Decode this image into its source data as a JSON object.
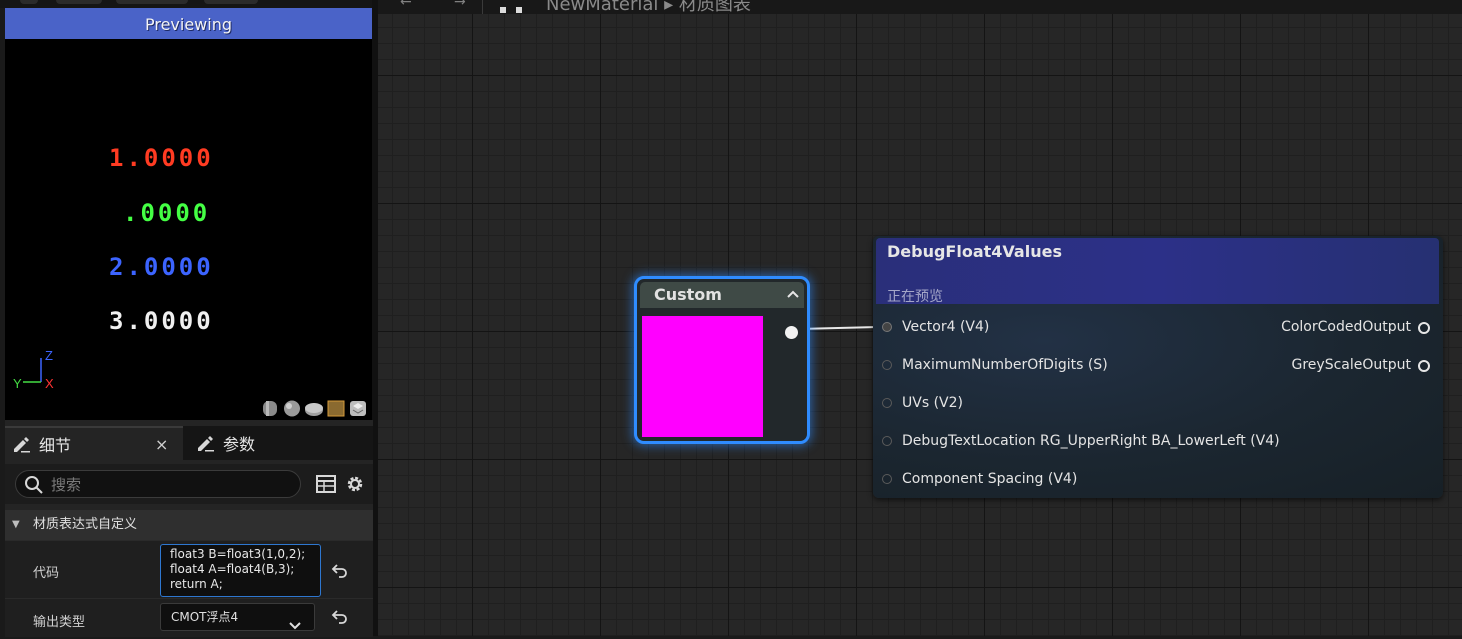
{
  "preview": {
    "banner": "Previewing",
    "debug_lines": [
      {
        "text": "1.0000",
        "color": "#ff3b22"
      },
      {
        "text": ".0000",
        "color": "#44ff44"
      },
      {
        "text": "2.0000",
        "color": "#3c64ff"
      },
      {
        "text": "3.0000",
        "color": "#f0f0f0"
      }
    ],
    "axis": {
      "z": "Z",
      "y": "Y",
      "x": "X",
      "z_color": "#3c64ff",
      "y_color": "#44dd44",
      "x_color": "#ff3333"
    }
  },
  "details": {
    "tabs": [
      {
        "label": "细节",
        "icon": "edit-icon",
        "active": true
      },
      {
        "label": "参数",
        "icon": "edit-icon",
        "active": false
      }
    ],
    "close_label": "×",
    "search_placeholder": "搜索",
    "section_title": "材质表达式自定义",
    "properties": {
      "code_label": "代码",
      "code_value": "float3 B=float3(1,0,2);\nfloat4 A=float4(B,3);\nreturn A;",
      "output_type_label": "输出类型",
      "output_type_value": "CMOT浮点4"
    }
  },
  "graph": {
    "breadcrumb": "NewMaterial ▸ 材质图表",
    "custom_node": {
      "title": "Custom",
      "preview_color": "#ff00ff",
      "border_color": "#2f8cff"
    },
    "debug_node": {
      "title": "DebugFloat4Values",
      "status": "正在预览",
      "inputs": [
        "Vector4 (V4)",
        "MaximumNumberOfDigits (S)",
        "UVs (V2)",
        "DebugTextLocation RG_UpperRight BA_LowerLeft (V4)",
        "Component Spacing (V4)"
      ],
      "outputs": [
        "ColorCodedOutput",
        "GreyScaleOutput"
      ]
    }
  }
}
